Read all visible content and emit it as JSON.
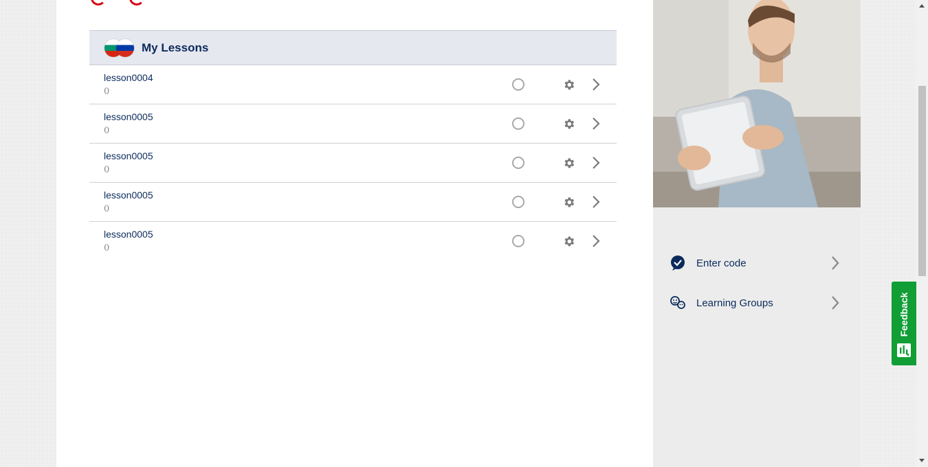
{
  "lessons": {
    "title": "My Lessons",
    "flags": [
      "bulgarian-flag-icon",
      "russian-flag-icon"
    ],
    "items": [
      {
        "name": "lesson0004",
        "count": "0"
      },
      {
        "name": "lesson0005",
        "count": "0"
      },
      {
        "name": "lesson0005",
        "count": "0"
      },
      {
        "name": "lesson0005",
        "count": "0"
      },
      {
        "name": "lesson0005",
        "count": "0"
      }
    ]
  },
  "sidebar": {
    "items": [
      {
        "label": "Enter code",
        "icon": "checkmark-bubble-icon"
      },
      {
        "label": "Learning Groups",
        "icon": "group-faces-icon"
      }
    ]
  },
  "feedback": {
    "label": "Feedback"
  },
  "colors": {
    "navy": "#0b2a5c",
    "header_bg": "#e6e8ef",
    "feedback_green": "#119e36",
    "brand_red": "#d7000f"
  }
}
